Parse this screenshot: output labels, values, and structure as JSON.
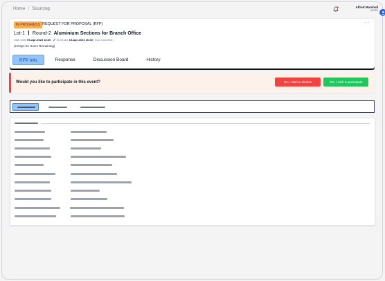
{
  "breadcrumb": {
    "home": "Home",
    "separator": "/",
    "current": "Sourcing"
  },
  "user": {
    "name": "Alfred Marshall",
    "role": "ADMIN"
  },
  "icons": {
    "notification": "bell-icon",
    "avatar": "user-avatar-icon",
    "more": "more-horizontal-icon"
  },
  "colors": {
    "accent": "#93c5fd",
    "status": "#f6ad55",
    "decline": "#ef4444",
    "accept": "#22c55e"
  },
  "rfp": {
    "status": "IN PROGRESS",
    "kind": "REQUEST FOR PROPOSAL (RFP)",
    "lot": "Lot-1",
    "round": "Round-2",
    "title": "Aluminium Sections for Branch Office",
    "start_label": "Start Date",
    "start_value": "09-Apr-2023 18:30",
    "end_label": "End Date",
    "end_value": "19-Apr-2023 16:30",
    "tz_note": "(Your local time)",
    "remaining": "(2 Days 04 Hours Remaining)",
    "more": "···"
  },
  "tabs": [
    {
      "label": "RFP Info",
      "active": true
    },
    {
      "label": "Response",
      "active": false
    },
    {
      "label": "Discussion Board",
      "active": false
    },
    {
      "label": "History",
      "active": false
    }
  ],
  "participation": {
    "question": "Would you like to participate in this event?",
    "decline_label": "No, I wish to decline",
    "accept_label": "Yes, I wish to participate"
  }
}
